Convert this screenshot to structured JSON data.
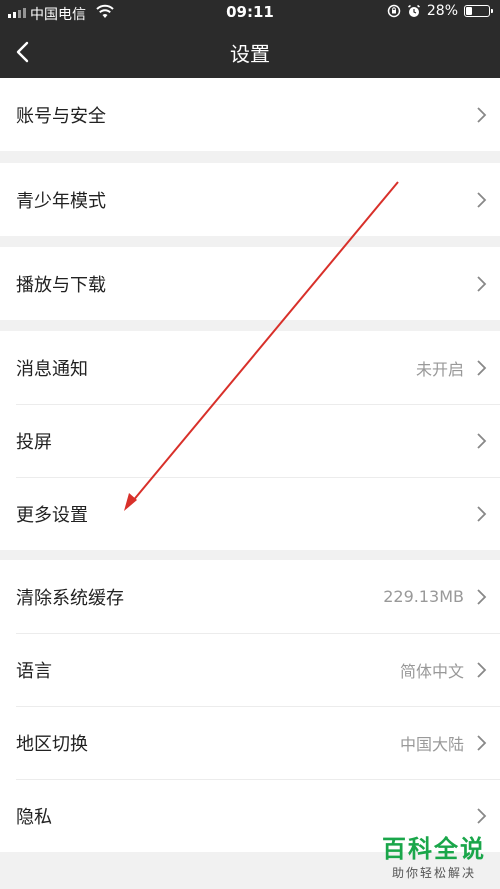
{
  "status_bar": {
    "carrier": "中国电信",
    "time": "09:11",
    "battery_percent": "28%",
    "battery_level": 0.28,
    "icons": [
      "signal-icon",
      "wifi-icon",
      "orientation-lock-icon",
      "alarm-icon",
      "battery-icon"
    ]
  },
  "nav": {
    "title": "设置",
    "back_icon": "back-chevron-icon"
  },
  "groups": [
    {
      "items": [
        {
          "label": "账号与安全",
          "value": ""
        }
      ]
    },
    {
      "items": [
        {
          "label": "青少年模式",
          "value": ""
        }
      ]
    },
    {
      "items": [
        {
          "label": "播放与下载",
          "value": ""
        }
      ]
    },
    {
      "items": [
        {
          "label": "消息通知",
          "value": "未开启"
        },
        {
          "label": "投屏",
          "value": ""
        },
        {
          "label": "更多设置",
          "value": ""
        }
      ]
    },
    {
      "items": [
        {
          "label": "清除系统缓存",
          "value": "229.13MB"
        },
        {
          "label": "语言",
          "value": "简体中文"
        },
        {
          "label": "地区切换",
          "value": "中国大陆"
        },
        {
          "label": "隐私",
          "value": ""
        }
      ]
    }
  ],
  "watermark": {
    "logo": "百科全说",
    "subtitle": "助你轻松解决"
  },
  "colors": {
    "nav_background": "#2b2b2b",
    "page_background": "#f1f1f1",
    "annotation_arrow": "#d8302a",
    "watermark_green": "#1aa64a"
  }
}
